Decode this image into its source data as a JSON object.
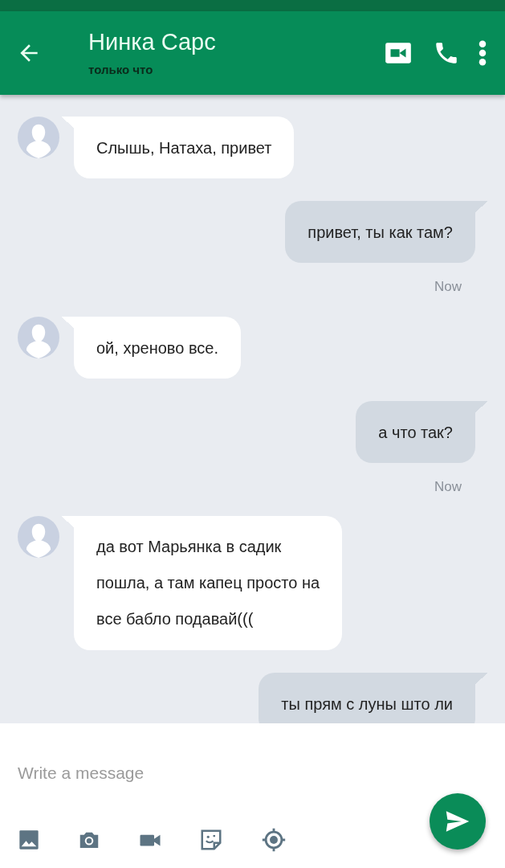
{
  "header": {
    "title": "Нинка Сарс",
    "subtitle": "только что"
  },
  "messages": [
    {
      "kind": "in",
      "lines": [
        "Слышь, Натаха, привет"
      ]
    },
    {
      "kind": "out",
      "lines": [
        "привет, ты как там?"
      ],
      "time": "Now"
    },
    {
      "kind": "in",
      "lines": [
        "ой, хреново все."
      ]
    },
    {
      "kind": "out",
      "lines": [
        "а что так?"
      ],
      "time": "Now"
    },
    {
      "kind": "in",
      "lines": [
        "да вот Марьянка в садик",
        "пошла, а там капец просто на",
        "все бабло подавай((("
      ]
    },
    {
      "kind": "out",
      "lines": [
        "ты прям с луны што ли"
      ]
    }
  ],
  "composer": {
    "placeholder": "Write a message"
  }
}
